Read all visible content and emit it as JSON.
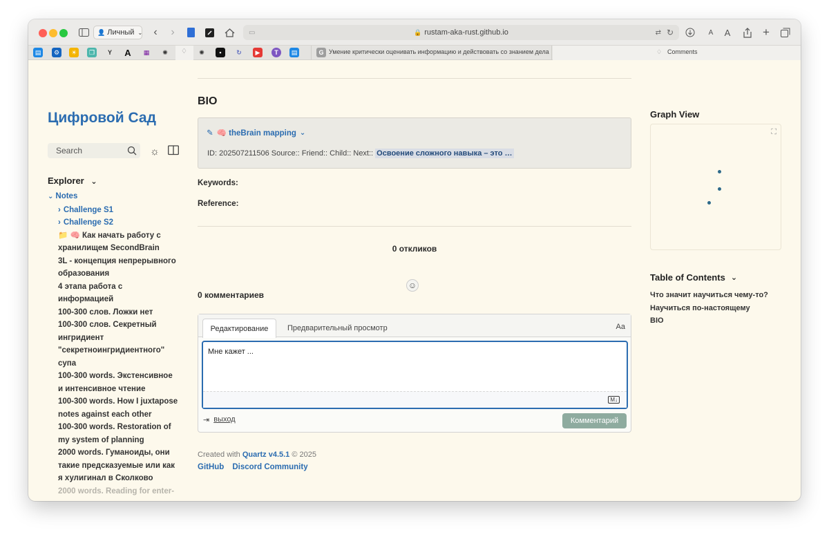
{
  "browser": {
    "profile_label": "Личный",
    "url": "rustam-aka-rust.github.io",
    "tab_active_title": "Умение критически оценивать информацию и действовать со знанием дела",
    "tab_comments_title": "Comments",
    "font_small": "A",
    "font_large": "A"
  },
  "sidebar": {
    "site_title": "Цифровой Сад",
    "search_placeholder": "Search",
    "explorer_label": "Explorer",
    "root_folder": "Notes",
    "items": [
      {
        "label": "Challenge S1",
        "type": "folder"
      },
      {
        "label": "Challenge S2",
        "type": "folder"
      },
      {
        "label": "📁 🧠 Как начать работу с хранилищем SecondBrain",
        "type": "note"
      },
      {
        "label": "3L - концепция непрерывного образования",
        "type": "note"
      },
      {
        "label": "4 этапа работа с информацией",
        "type": "note"
      },
      {
        "label": "100-300 слов. Ложки нет",
        "type": "note"
      },
      {
        "label": "100-300 слов. Секретный ингридиент \"секретноингридиентного\" супа",
        "type": "note"
      },
      {
        "label": "100-300 words. Экстенсивное и интенсивное чтение",
        "type": "note"
      },
      {
        "label": "100-300 words. How I juxtapose notes against each other",
        "type": "note"
      },
      {
        "label": "100-300 words. Restoration of my system of planning",
        "type": "note"
      },
      {
        "label": "2000 words. Гуманоиды, они такие предсказуемые или как я хулигинал в Сколково",
        "type": "note"
      },
      {
        "label": "2000 words. Reading for enter-",
        "type": "note"
      }
    ]
  },
  "main": {
    "title": "BIO",
    "callout": {
      "title": "🧠 theBrain mapping",
      "meta_prefix": "ID: 202507211506 Source:: Friend:: Child:: Next::",
      "meta_link": "Освоение сложного навыка – это …"
    },
    "keywords_label": "Keywords",
    "reference_label": "Reference",
    "reactions_count": "0 откликов",
    "comments_count": "0 комментариев",
    "comment_box": {
      "tab_edit": "Редактирование",
      "tab_preview": "Предварительный просмотр",
      "font_toggle": "Aa",
      "value": "Мне кажет ...",
      "logout": "выход",
      "submit": "Комментарий"
    },
    "footer": {
      "created_with": "Created with",
      "quartz": "Quartz v4.5.1",
      "year": "© 2025",
      "github": "GitHub",
      "discord": "Discord Community"
    }
  },
  "right": {
    "graph_title": "Graph View",
    "toc_title": "Table of Contents",
    "toc": [
      "Что значит научиться чему-то?",
      "Научиться по-настоящему",
      "BIO"
    ]
  }
}
